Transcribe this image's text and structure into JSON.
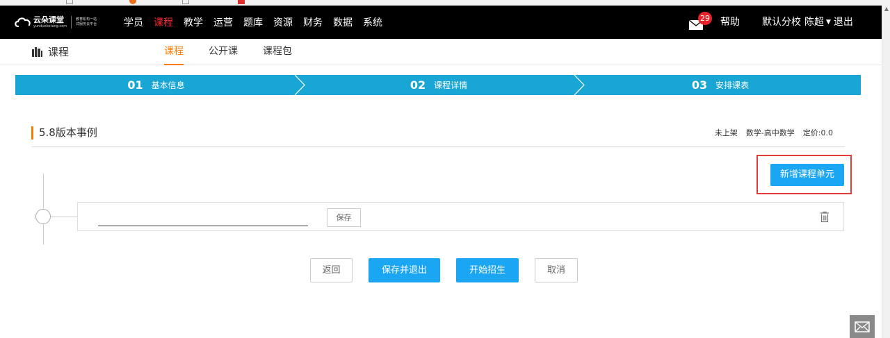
{
  "topbar": {
    "logo": {
      "name": "云朵课堂",
      "domain": "yunduoketang.com",
      "slogan_line1": "教育机构一站",
      "slogan_line2": "式服务云平台"
    },
    "nav": [
      {
        "label": "学员",
        "active": false
      },
      {
        "label": "课程",
        "active": true
      },
      {
        "label": "教学",
        "active": false
      },
      {
        "label": "运营",
        "active": false
      },
      {
        "label": "题库",
        "active": false
      },
      {
        "label": "资源",
        "active": false
      },
      {
        "label": "财务",
        "active": false
      },
      {
        "label": "数据",
        "active": false
      },
      {
        "label": "系统",
        "active": false
      }
    ],
    "mail_count": "29",
    "help_label": "帮助",
    "campus": "默认分校",
    "user_name": "陈超",
    "logout_label": "退出"
  },
  "subbar": {
    "title": "课程",
    "tabs": [
      {
        "label": "课程",
        "active": true
      },
      {
        "label": "公开课",
        "active": false
      },
      {
        "label": "课程包",
        "active": false
      }
    ]
  },
  "steps": [
    {
      "number": "01",
      "label": "基本信息"
    },
    {
      "number": "02",
      "label": "课程详情"
    },
    {
      "number": "03",
      "label": "安排课表"
    }
  ],
  "course": {
    "title": "5.8版本事例",
    "status": "未上架",
    "category": "数学-高中数学",
    "price": "定价:0.0"
  },
  "unit": {
    "add_label": "新增课程单元",
    "input_value": "",
    "save_label": "保存"
  },
  "actions": {
    "back_label": "返回",
    "save_exit_label": "保存并退出",
    "enroll_label": "开始招生",
    "cancel_label": "取消"
  },
  "colors": {
    "accent_blue": "#1aa6f3",
    "step_blue": "#1aa6d4",
    "accent_orange": "#ff7a00",
    "nav_active_red": "#ff2a2a",
    "highlight_red": "#e53a3a",
    "badge_red": "#e8222a"
  },
  "icons": [
    "mail-icon",
    "books-icon",
    "trash-icon",
    "caret-down-icon",
    "float-mail-icon",
    "cloud-logo-icon"
  ]
}
